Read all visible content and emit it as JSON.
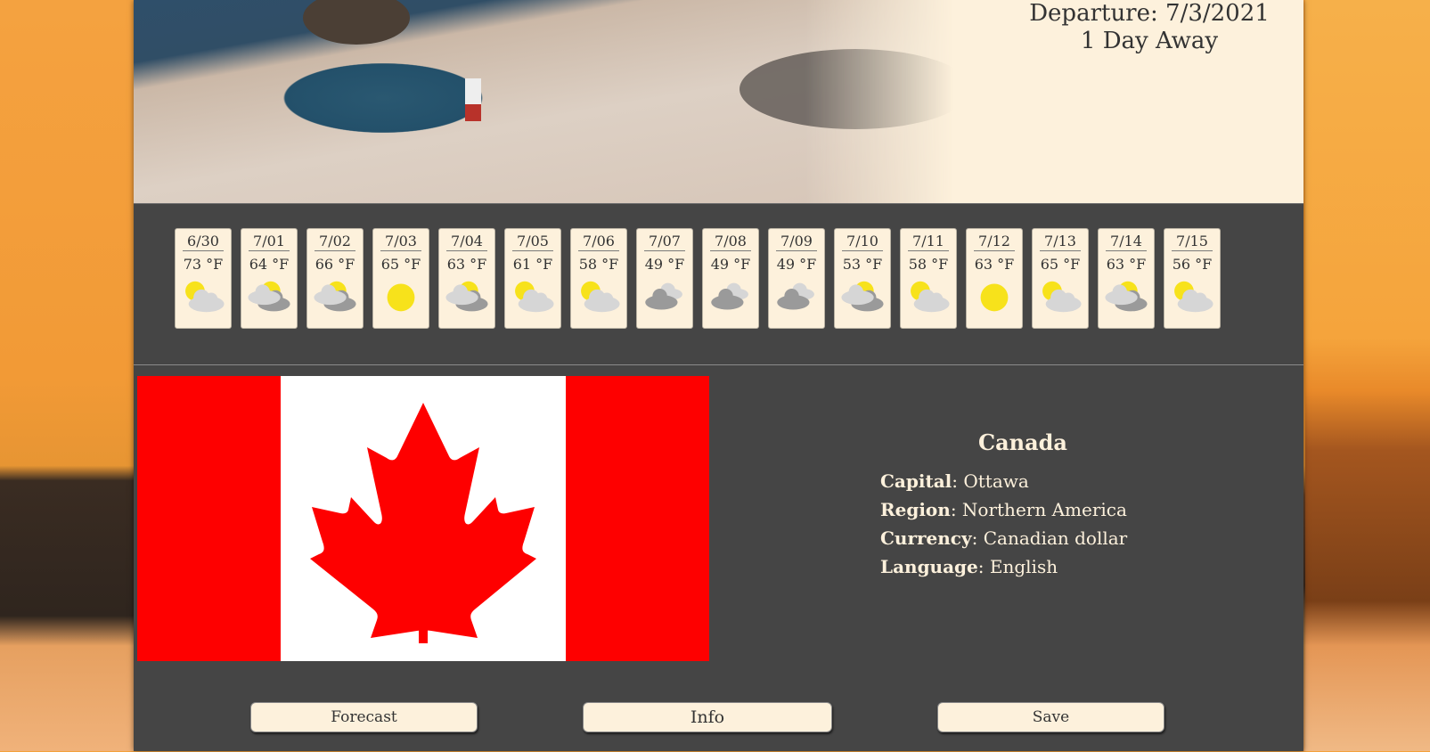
{
  "trip": {
    "departure": "Departure: 7/3/2021",
    "countdown": "1 Day Away"
  },
  "forecast": [
    {
      "date": "6/30",
      "temp": "73 °F",
      "icon": "sun-behind-cloud-icon"
    },
    {
      "date": "7/01",
      "temp": "64 °F",
      "icon": "partly-cloudy-icon"
    },
    {
      "date": "7/02",
      "temp": "66 °F",
      "icon": "partly-cloudy-icon"
    },
    {
      "date": "7/03",
      "temp": "65 °F",
      "icon": "sun-icon"
    },
    {
      "date": "7/04",
      "temp": "63 °F",
      "icon": "partly-cloudy-icon"
    },
    {
      "date": "7/05",
      "temp": "61 °F",
      "icon": "sun-behind-cloud-icon"
    },
    {
      "date": "7/06",
      "temp": "58 °F",
      "icon": "sun-behind-cloud-icon"
    },
    {
      "date": "7/07",
      "temp": "49 °F",
      "icon": "cloudy-icon"
    },
    {
      "date": "7/08",
      "temp": "49 °F",
      "icon": "cloudy-icon"
    },
    {
      "date": "7/09",
      "temp": "49 °F",
      "icon": "cloudy-icon"
    },
    {
      "date": "7/10",
      "temp": "53 °F",
      "icon": "partly-cloudy-icon"
    },
    {
      "date": "7/11",
      "temp": "58 °F",
      "icon": "sun-behind-cloud-icon"
    },
    {
      "date": "7/12",
      "temp": "63 °F",
      "icon": "sun-icon"
    },
    {
      "date": "7/13",
      "temp": "65 °F",
      "icon": "sun-behind-cloud-icon"
    },
    {
      "date": "7/14",
      "temp": "63 °F",
      "icon": "partly-cloudy-icon"
    },
    {
      "date": "7/15",
      "temp": "56 °F",
      "icon": "sun-behind-cloud-icon"
    }
  ],
  "country": {
    "name": "Canada",
    "capital_label": "Capital",
    "capital": "Ottawa",
    "region_label": "Region",
    "region": "Northern America",
    "currency_label": "Currency",
    "currency": "Canadian dollar",
    "language_label": "Language",
    "language": "English",
    "flag_colors": {
      "red": "#fe0000",
      "white": "#ffffff"
    }
  },
  "buttons": {
    "forecast": "Forecast",
    "info": "Info",
    "save": "Save"
  },
  "colors": {
    "panel": "#454545",
    "cream": "#fdf1dc",
    "sun": "#f7e21b",
    "cloud_light": "#d6d6d6",
    "cloud_dark": "#9a9a9a"
  }
}
